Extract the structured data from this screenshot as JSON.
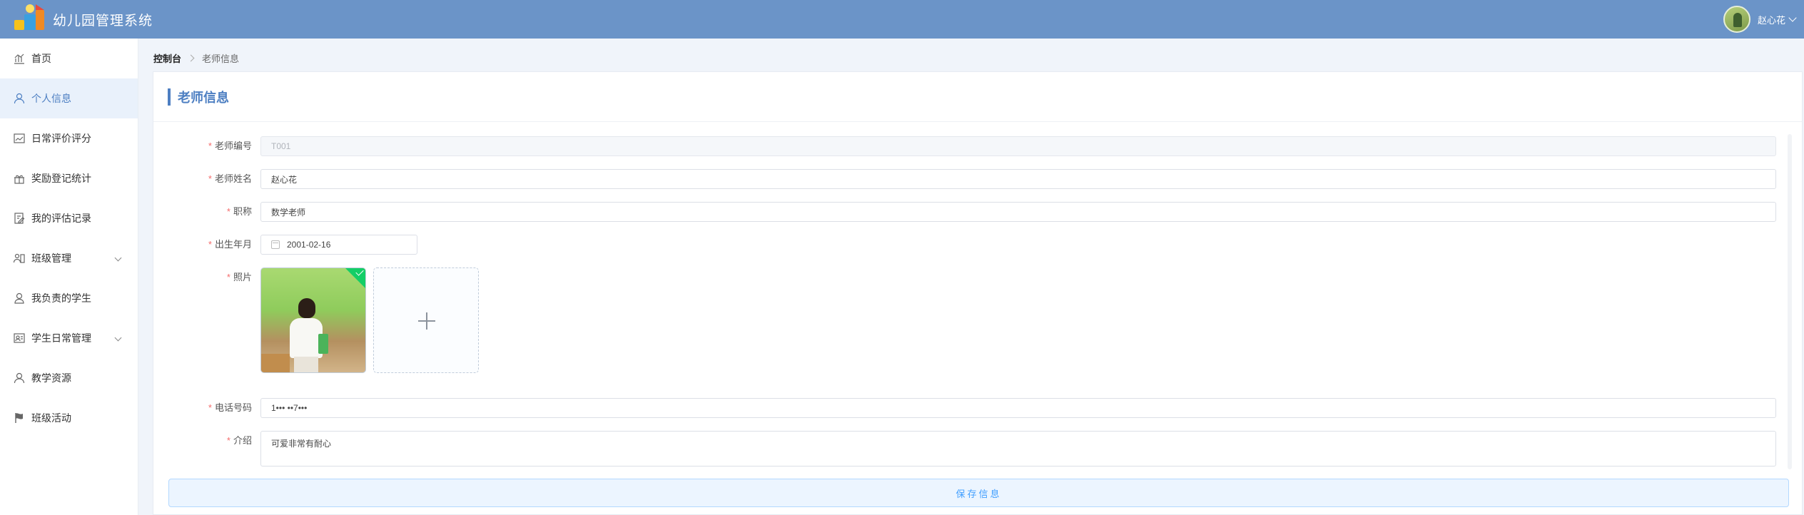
{
  "header": {
    "app_title": "幼儿园管理系统",
    "username": "赵心花"
  },
  "sidebar": {
    "items": [
      {
        "label": "首页",
        "icon": "chart-icon"
      },
      {
        "label": "个人信息",
        "icon": "user-icon",
        "active": true
      },
      {
        "label": "日常评价评分",
        "icon": "line-chart-icon"
      },
      {
        "label": "奖励登记统计",
        "icon": "gift-icon"
      },
      {
        "label": "我的评估记录",
        "icon": "edit-note-icon"
      },
      {
        "label": "班级管理",
        "icon": "class-icon",
        "expandable": true
      },
      {
        "label": "我负责的学生",
        "icon": "student-icon"
      },
      {
        "label": "学生日常管理",
        "icon": "student-daily-icon",
        "expandable": true
      },
      {
        "label": "教学资源",
        "icon": "resource-icon"
      },
      {
        "label": "班级活动",
        "icon": "flag-icon"
      }
    ]
  },
  "breadcrumb": {
    "home": "控制台",
    "current": "老师信息"
  },
  "form": {
    "title": "老师信息",
    "fields": {
      "teacher_id": {
        "label": "老师编号",
        "value": "T001"
      },
      "teacher_name": {
        "label": "老师姓名",
        "value": "赵心花"
      },
      "job_title": {
        "label": "职称",
        "value": "数学老师"
      },
      "birth_date": {
        "label": "出生年月",
        "value": "2001-02-16"
      },
      "photo": {
        "label": "照片"
      },
      "phone": {
        "label": "电话号码",
        "value": "1••• ••7•••"
      },
      "intro": {
        "label": "介绍",
        "value": "可爱非常有耐心"
      }
    },
    "required_mark": "*",
    "save_label": "保存信息"
  },
  "colors": {
    "header_bg": "#6b94c8",
    "accent": "#4d7fc2",
    "upload_success": "#13ce66",
    "button_text": "#409eff"
  }
}
